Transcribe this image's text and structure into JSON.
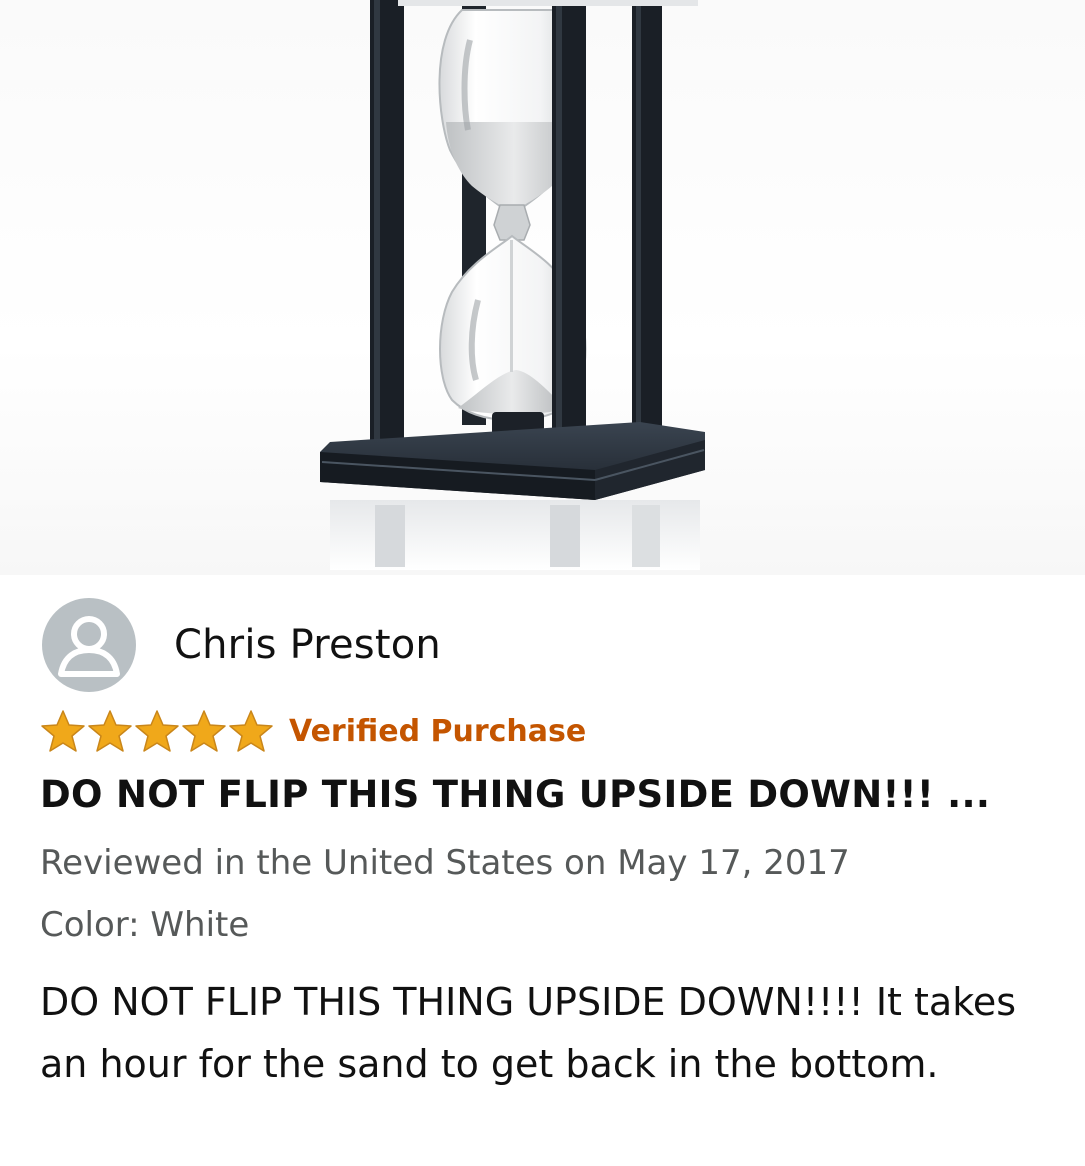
{
  "product_image": {
    "icon": "hourglass-product-photo"
  },
  "review": {
    "reviewer": {
      "name": "Chris Preston",
      "avatar_icon": "default-user-avatar-icon"
    },
    "rating": {
      "stars_filled": 5,
      "stars_total": 5,
      "star_color": "#f0a81a"
    },
    "verified_label": "Verified Purchase",
    "verified_color": "#c45500",
    "title": "DO NOT FLIP THIS THING UPSIDE DOWN!!! ...",
    "date_line": "Reviewed in the United States on May 17, 2017",
    "color_line": "Color: White",
    "body": "DO NOT FLIP THIS THING UPSIDE DOWN!!!! It takes an hour for the sand to get back in the bottom."
  }
}
